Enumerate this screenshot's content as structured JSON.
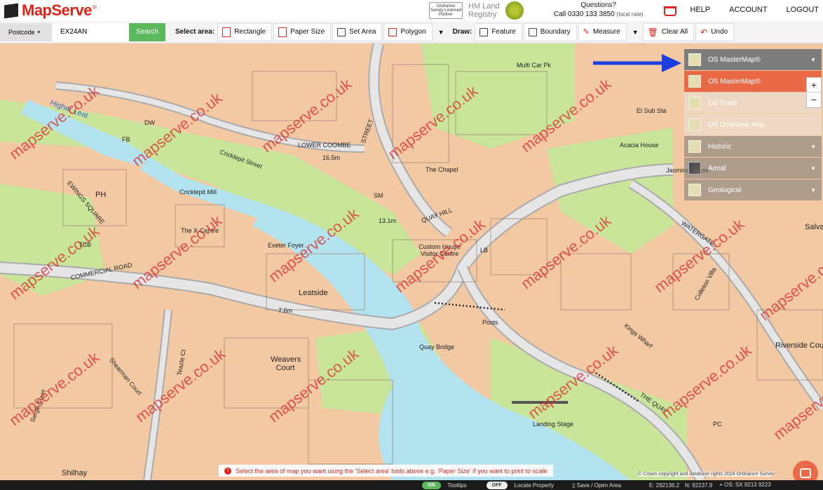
{
  "header": {
    "logo_text": "MapServe",
    "logo_mark": "®",
    "partner_os": "Ordnance Survey Licensed Partner",
    "land_registry_line1": "HM Land",
    "land_registry_line2": "Registry",
    "questions": "Questions?",
    "phone": "Call 0330 133 3850",
    "phone_note": "(local rate)",
    "nav": [
      "HELP",
      "ACCOUNT",
      "LOGOUT"
    ]
  },
  "toolbar": {
    "postcode_label": "Postcode",
    "postcode_value": "EX24AN",
    "search_label": "Search",
    "select_area_label": "Select area:",
    "select_tools": [
      "Rectangle",
      "Paper Size",
      "Set Area",
      "Polygon"
    ],
    "draw_label": "Draw:",
    "draw_tools": [
      "Feature",
      "Boundary",
      "Measure"
    ],
    "clear_all": "Clear All",
    "undo": "Undo"
  },
  "layers": {
    "current": "OS MasterMap®",
    "items": [
      "OS MasterMap®",
      "OS Road",
      "OS Overview Map",
      "Historic",
      "Aerial",
      "Geological"
    ]
  },
  "zoom": {
    "in": "+",
    "out": "−"
  },
  "map": {
    "watermark": "mapserve.co.uk",
    "labels": [
      "Higher Leat",
      "LOWER COOMBE",
      "STREET",
      "16.5m",
      "Cricklepit Street",
      "Cricklepit Mill",
      "The X-Centre",
      "Exeter Foyer",
      "PH",
      "COMMERCIAL ROAD",
      "Leatside",
      "7.6m",
      "Weavers Court",
      "Custom House Visitor Centre",
      "QUAY HILL",
      "13.1m",
      "The Chapel",
      "Multi Car Pk",
      "El Sub Sta",
      "Acacia House",
      "Jasmine House",
      "Quay Bridge",
      "Kings Wharf",
      "Riverside Court",
      "Landing Stage",
      "THE QUAY",
      "WATERGATE",
      "Colleton Villa",
      "Shilhay",
      "Shearman Court",
      "Teazle Ct",
      "Serge Court",
      "EWINGS SQUARE",
      "TCB",
      "FB",
      "DW",
      "SM",
      "LB",
      "PC",
      "Posts",
      "Salva Te"
    ]
  },
  "tip": "Select the area of map you want using the 'Select area' tools above e.g. 'Paper Size' if you want to print to scale",
  "copyright": "© Crown copyright and database rights 2024 Ordnance Survey",
  "status": {
    "tooltips_state": "ON",
    "tooltips_label": "Tooltips",
    "locate_state": "OFF",
    "locate_label": "Locate Property",
    "save_label": "Save / Open Area",
    "easting": "E: 292136.2",
    "northing": "N: 92237.9",
    "osref": "OS: SX 9213 9223"
  }
}
